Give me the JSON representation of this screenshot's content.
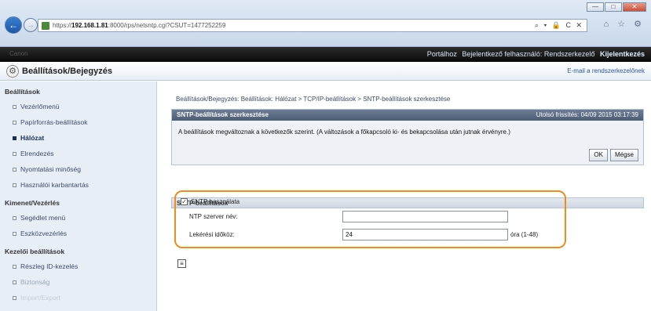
{
  "browser": {
    "url_prefix": "https://",
    "url_host": "192.168.1.81",
    "url_rest": ":8000/rps/netsntp.cgi?CSUT=1477252259",
    "addr_tools": "⌕ ▾ 🔒 C ✕",
    "toolbar_icons": "⌂ ☆ ⚙",
    "window_controls": [
      "—",
      "□",
      "✕"
    ]
  },
  "topbar": {
    "device_name": "Canon",
    "device_model": "",
    "links": [
      "Portálhoz",
      "Bejelentkező felhasználó: Rendszerkezelő",
      "Kijelentkezés"
    ]
  },
  "header": {
    "title": "Beállítások/Bejegyzés",
    "mail_link": "E-mail a rendszerkezelőnek"
  },
  "sidebar": {
    "sections": [
      {
        "title": "Beállítások",
        "items": [
          {
            "label": "Vezérlőmenü",
            "state": "normal"
          },
          {
            "label": "Papírforrás-beállítások",
            "state": "normal"
          },
          {
            "label": "Hálózat",
            "state": "active"
          },
          {
            "label": "Elrendezés",
            "state": "normal"
          },
          {
            "label": "Nyomtatási minőség",
            "state": "normal"
          },
          {
            "label": "Használói karbantartás",
            "state": "normal"
          }
        ]
      },
      {
        "title": "Kimenet/Vezérlés",
        "items": [
          {
            "label": "Segédlet menü",
            "state": "normal"
          },
          {
            "label": "Eszközvezérlés",
            "state": "normal"
          }
        ]
      },
      {
        "title": "Kezelői beállítások",
        "items": [
          {
            "label": "Részleg ID-kezelés",
            "state": "normal"
          },
          {
            "label": "Biztonság",
            "state": "faded"
          },
          {
            "label": "Import/Export",
            "state": "faded2"
          }
        ]
      }
    ]
  },
  "main": {
    "breadcrumb": "Beállítások/Bejegyzés: Beállítások: Hálózat > TCP/IP-beállítások > SNTP-beállítások szerkesztése",
    "edit_panel": {
      "title": "SNTP-beállítások szerkesztése",
      "last_updated": "Utolsó frissítés: 04/09 2015 03:17:39",
      "message": "A beállítások megváltoznak a következők szerint. (A változások a főkapcsoló ki- és bekapcsolása után jutnak érvényre.)",
      "ok_label": "OK",
      "cancel_label": "Mégse"
    },
    "sntp_panel": {
      "title": "SNTP-beállítások",
      "use_sntp_label": "SNTP használata",
      "use_sntp_checked": true,
      "ntp_server_label": "NTP szerver név:",
      "ntp_server_value": "",
      "interval_label": "Lekérési időköz:",
      "interval_value": "24",
      "interval_unit": "óra (1-48)"
    },
    "highlight_color": "#f08c1a"
  }
}
